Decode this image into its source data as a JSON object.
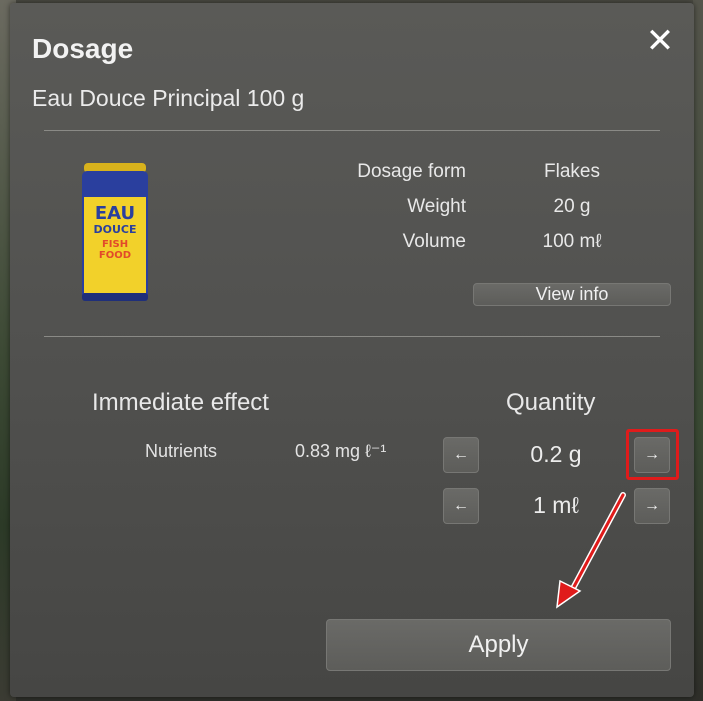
{
  "dialog": {
    "title": "Dosage",
    "product_name": "Eau Douce Principal 100 g"
  },
  "product_image": {
    "label_line1": "EAU",
    "label_line2": "DOUCE",
    "label_line3": "FISH",
    "label_line4": "FOOD"
  },
  "specs": [
    {
      "label": "Dosage form",
      "value": "Flakes"
    },
    {
      "label": "Weight",
      "value": "20 g"
    },
    {
      "label": "Volume",
      "value": "100 mℓ"
    }
  ],
  "view_info_label": "View info",
  "immediate_effect": {
    "heading": "Immediate effect",
    "nutrient_label": "Nutrients",
    "nutrient_value": "0.83 mg ℓ⁻¹"
  },
  "quantity": {
    "heading": "Quantity",
    "weight_value": "0.2 g",
    "volume_value": "1 mℓ",
    "decrease_glyph": "←",
    "increase_glyph": "→"
  },
  "apply_label": "Apply",
  "icons": {
    "close": "close-icon",
    "decrease": "arrow-left-icon",
    "increase": "arrow-right-icon"
  },
  "colors": {
    "highlight": "#e01b1b",
    "can_body": "#2a3f9e",
    "can_label": "#f2d12a"
  }
}
